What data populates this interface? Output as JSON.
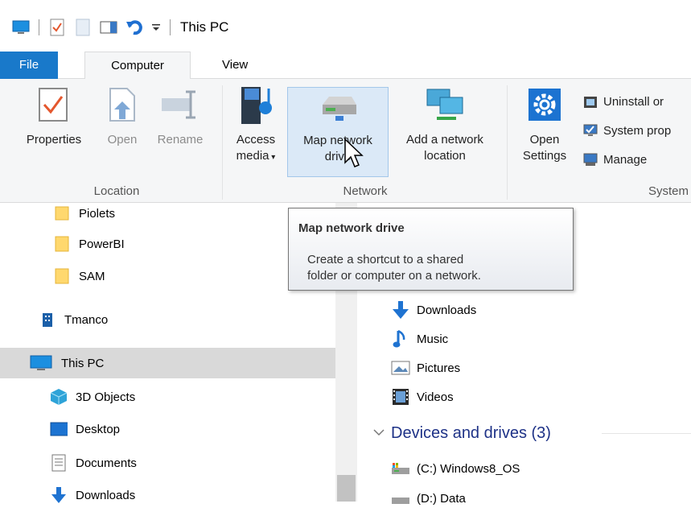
{
  "window": {
    "title": "This PC"
  },
  "tabs": {
    "file": "File",
    "computer": "Computer",
    "view": "View"
  },
  "ribbon": {
    "location": {
      "properties": "Properties",
      "open": "Open",
      "rename": "Rename",
      "label": "Location"
    },
    "network": {
      "access_media_line1": "Access",
      "access_media_line2": "media",
      "map_drive_line1": "Map network",
      "map_drive_line2": "drive",
      "add_location_line1": "Add a network",
      "add_location_line2": "location",
      "label": "Network"
    },
    "system": {
      "open_settings_line1": "Open",
      "open_settings_line2": "Settings",
      "uninstall": "Uninstall or",
      "system_properties": "System prop",
      "manage": "Manage",
      "label": "System"
    }
  },
  "tooltip": {
    "title": "Map network drive",
    "line1": "Create a shortcut to a shared",
    "line2": "folder or computer on a network."
  },
  "nav": {
    "items": [
      {
        "label": "Piolets"
      },
      {
        "label": "PowerBI"
      },
      {
        "label": "SAM"
      },
      {
        "label": "Tmanco"
      },
      {
        "label": "This PC"
      },
      {
        "label": "3D Objects"
      },
      {
        "label": "Desktop"
      },
      {
        "label": "Documents"
      },
      {
        "label": "Downloads"
      }
    ]
  },
  "content": {
    "folders": [
      {
        "label": "Downloads"
      },
      {
        "label": "Music"
      },
      {
        "label": "Pictures"
      },
      {
        "label": "Videos"
      }
    ],
    "devices_header": "Devices and drives (3)",
    "drives": [
      {
        "label": "(C:) Windows8_OS"
      },
      {
        "label": "(D:) Data"
      }
    ]
  }
}
